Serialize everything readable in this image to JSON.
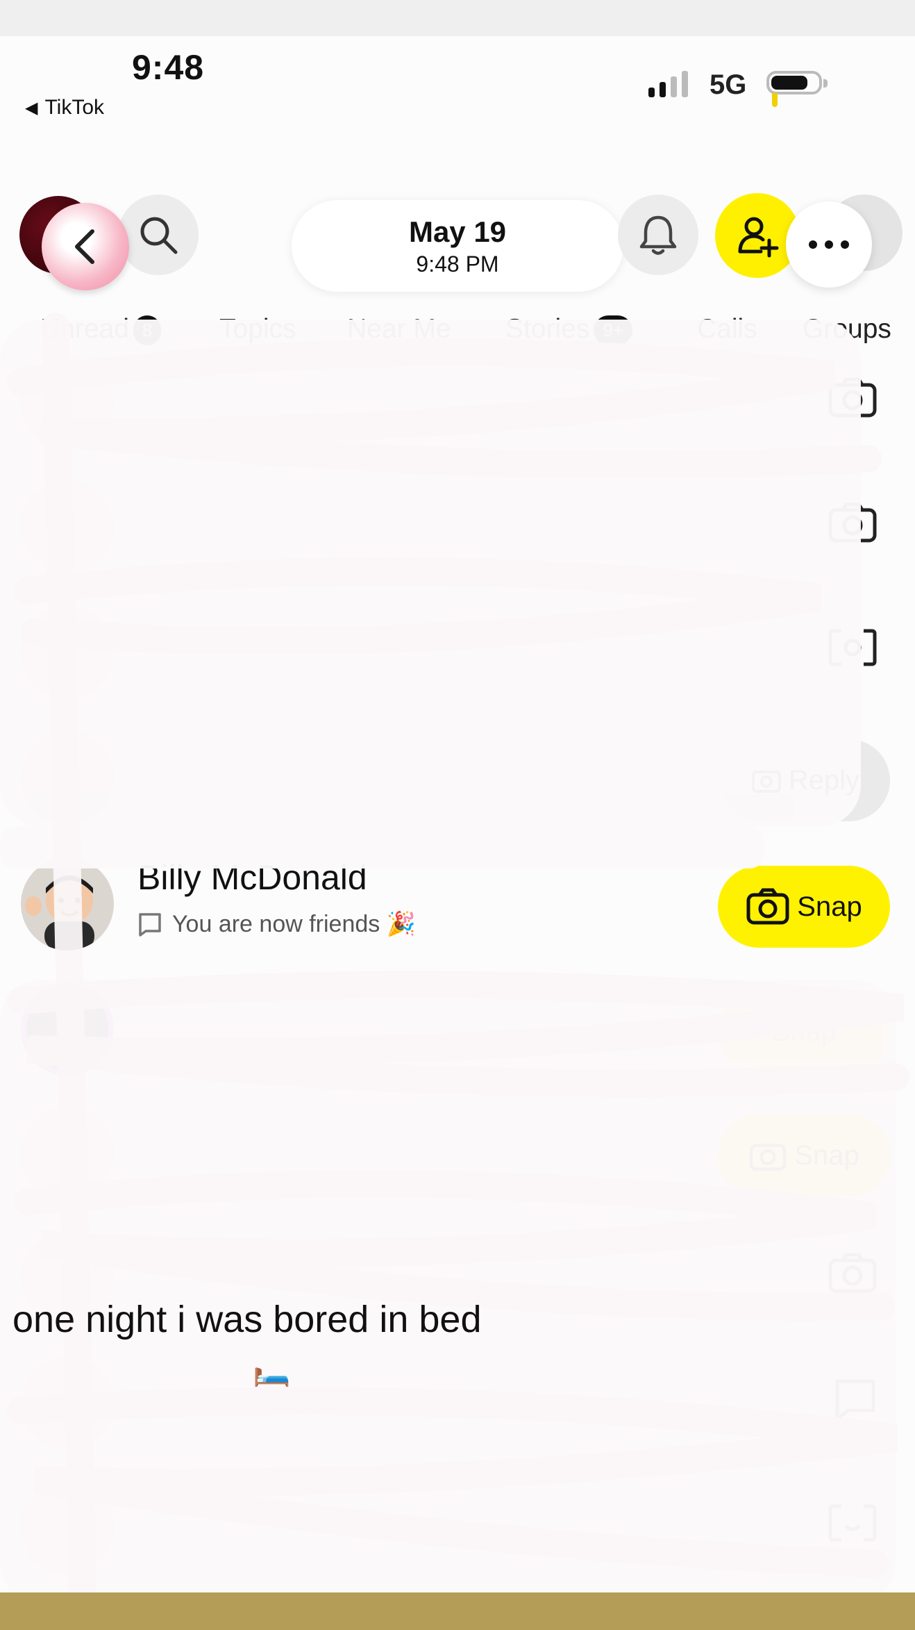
{
  "status_bar": {
    "time": "9:48",
    "back_app": "TikTok",
    "network": "5G"
  },
  "header": {
    "date": "May 19",
    "time": "9:48 PM"
  },
  "tabs": [
    {
      "label": "Unread",
      "badge": "8"
    },
    {
      "label": "Topics",
      "badge": ""
    },
    {
      "label": "Near Me",
      "badge": ""
    },
    {
      "label": "Stories",
      "badge": "9+"
    },
    {
      "label": "Calls",
      "badge": ""
    },
    {
      "label": "Groups",
      "badge": ""
    }
  ],
  "chats": [
    {
      "name": "",
      "status": "",
      "action": "camera-icon"
    },
    {
      "name": "",
      "status": "",
      "action": "camera-icon"
    },
    {
      "name": "",
      "status": "",
      "action": "camera-flip-icon"
    },
    {
      "name": "",
      "status": "",
      "action": "Reply"
    },
    {
      "name": "Billy McDonald",
      "status": "You are now friends 🎉",
      "action": "Snap"
    },
    {
      "name": "",
      "status": "",
      "action": "Snap"
    },
    {
      "name": "",
      "status": "",
      "action": "Snap"
    },
    {
      "name": "",
      "status": "",
      "action": "camera-icon"
    },
    {
      "name": "",
      "status": "",
      "action": "chat-icon"
    },
    {
      "name": "",
      "status": "",
      "action": "camera-flip-icon"
    }
  ],
  "caption": {
    "text": "one night i was bored in bed",
    "emoji": "🛏️"
  },
  "colors": {
    "snap_yellow": "#fff200",
    "accent_purple": "#b03cf0",
    "bottom_strip": "#b39d57"
  }
}
